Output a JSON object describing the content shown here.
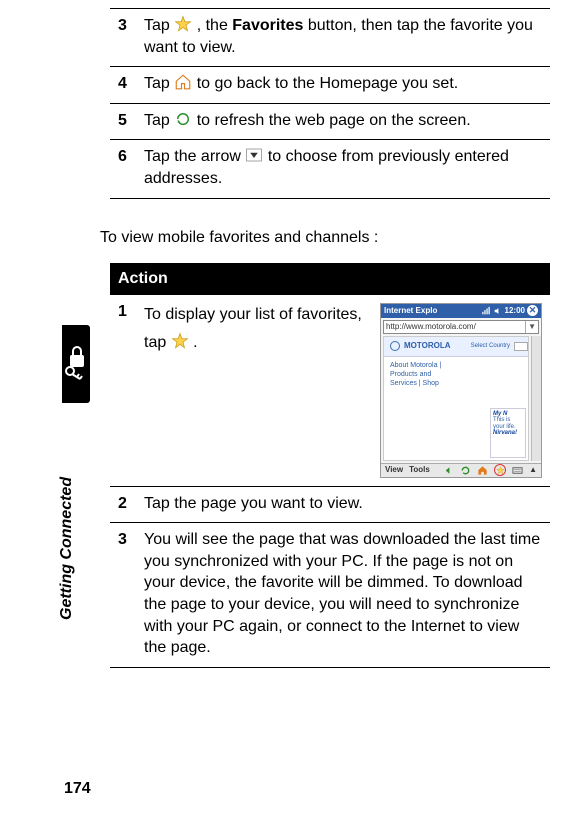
{
  "side_label": "Getting Connected",
  "page_number": "174",
  "top_steps": [
    {
      "num": "3",
      "text_parts": [
        "Tap ",
        " , the ",
        " button, then tap the favorite you want to view."
      ],
      "bold_word": "Favorites",
      "icon": "star-icon"
    },
    {
      "num": "4",
      "text_parts": [
        "Tap ",
        " to go back to the Homepage you set."
      ],
      "icon": "home-icon"
    },
    {
      "num": "5",
      "text_parts": [
        "Tap ",
        " to refresh the web page on the screen."
      ],
      "icon": "refresh-icon"
    },
    {
      "num": "6",
      "text_parts": [
        "Tap the arrow ",
        " to choose from previously entered addresses."
      ],
      "icon": "dropdown-arrow-icon"
    }
  ],
  "intro_text": "To view mobile favorites and channels :",
  "action_header": "Action",
  "bottom_steps": [
    {
      "num": "1",
      "text_parts": [
        "To display your list of favorites, tap ",
        " ."
      ],
      "icon": "star-icon"
    },
    {
      "num": "2",
      "text": "Tap the page you want to view."
    },
    {
      "num": "3",
      "text": "You will see the page that was downloaded the last time you synchronized with your PC. If the page is not on your device, the favorite will be dimmed. To download the page to your device, you will need to synchronize with your PC again, or connect to the Internet to view the page."
    }
  ],
  "screenshot": {
    "title": "Internet Explo",
    "time": "12:00",
    "url": "http://www.motorola.com/",
    "brand": "MOTOROLA",
    "select_label": "Select Country",
    "links_col1": "About Motorola | Products and Services | Shop",
    "ad_text1": "My N",
    "ad_text2": "Nirvana!",
    "footer_left1": "View",
    "footer_left2": "Tools"
  }
}
